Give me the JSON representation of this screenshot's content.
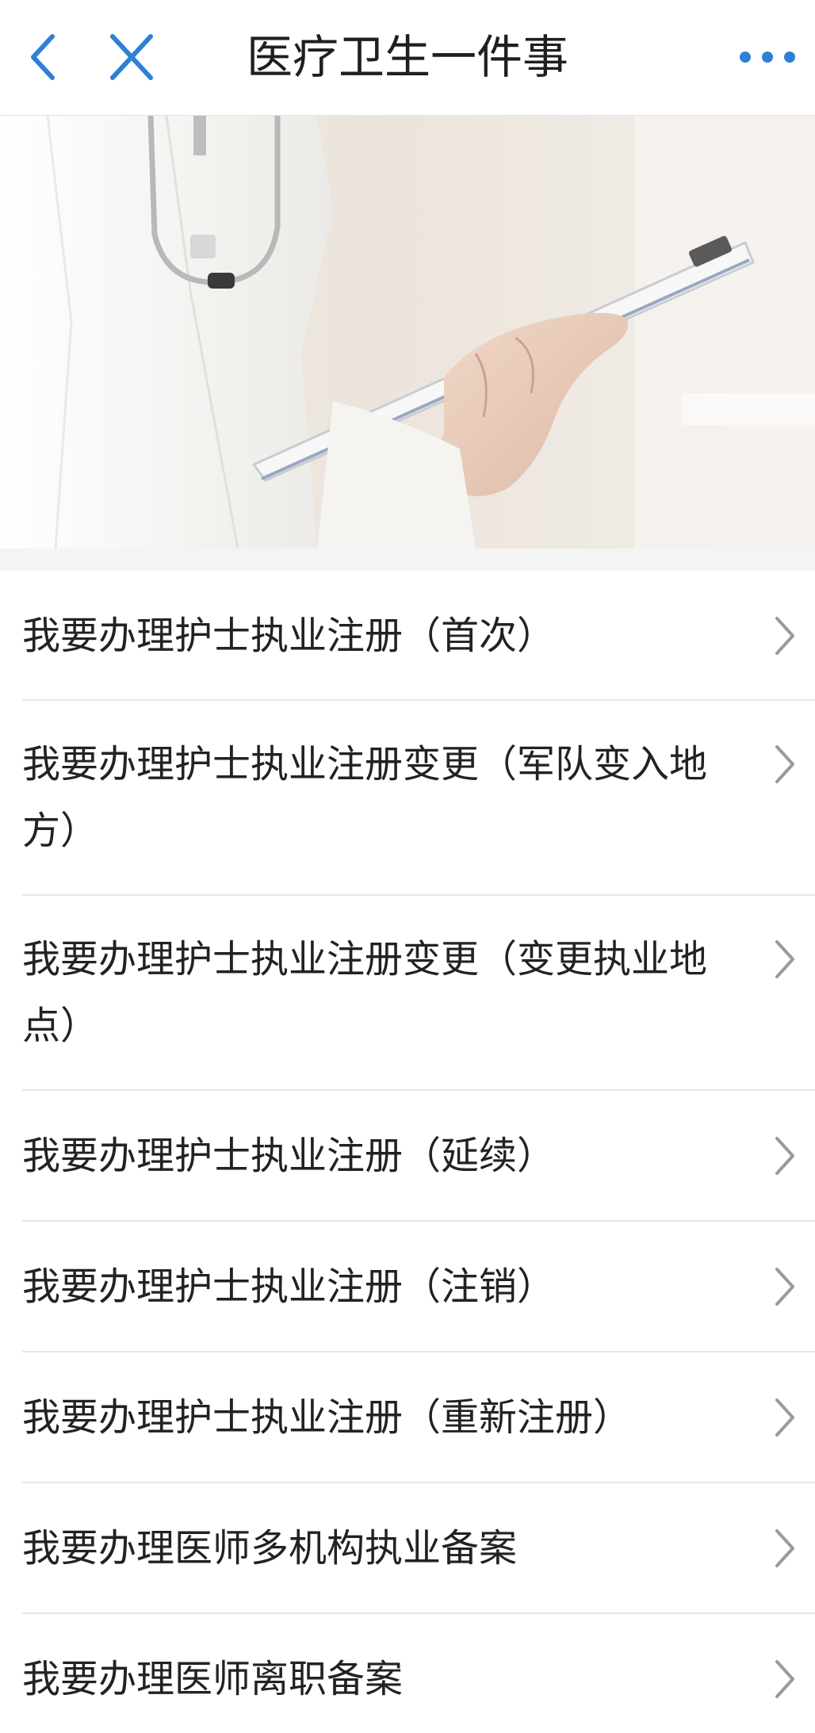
{
  "nav": {
    "title": "医疗卫生一件事",
    "back_icon": "chevron-left-icon",
    "close_icon": "close-icon",
    "more_icon": "more-horizontal-icon"
  },
  "banner": {
    "subject": "doctor-holding-clipboard-photo"
  },
  "items": [
    {
      "label": "我要办理护士执业注册（首次）"
    },
    {
      "label": "我要办理护士执业注册变更（军队变入地方）"
    },
    {
      "label": "我要办理护士执业注册变更（变更执业地点）"
    },
    {
      "label": "我要办理护士执业注册（延续）"
    },
    {
      "label": "我要办理护士执业注册（注销）"
    },
    {
      "label": "我要办理护士执业注册（重新注册）"
    },
    {
      "label": "我要办理医师多机构执业备案"
    },
    {
      "label": "我要办理医师离职备案"
    }
  ],
  "colors": {
    "accent": "#2e7fd6",
    "text": "#222222",
    "divider": "#e6e6e6",
    "chevron": "#9a9a9a"
  }
}
